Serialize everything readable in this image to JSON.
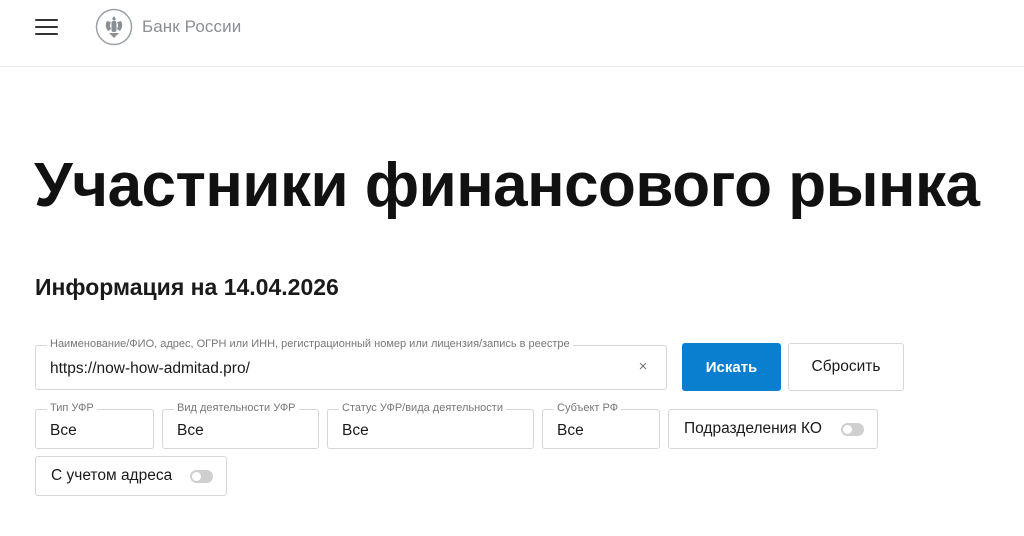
{
  "header": {
    "logo_text": "Банк России"
  },
  "page": {
    "title": "Участники финансового рынка",
    "info_date": "Информация на 14.04.2026"
  },
  "search": {
    "legend": "Наименование/ФИО, адрес, ОГРН или ИНН, регистрационный номер или лицензия/запись в реестре",
    "value": "https://now-how-admitad.pro/",
    "clear_symbol": "×",
    "search_button": "Искать",
    "reset_button": "Сбросить"
  },
  "filters": {
    "type": {
      "legend": "Тип УФР",
      "value": "Все"
    },
    "activity": {
      "legend": "Вид деятельности УФР",
      "value": "Все"
    },
    "status": {
      "legend": "Статус УФР/вида деятельности",
      "value": "Все"
    },
    "region": {
      "legend": "Субъект РФ",
      "value": "Все"
    },
    "branches_toggle": {
      "label": "Подразделения КО",
      "enabled": false
    },
    "address_toggle": {
      "label": "С учетом адреса",
      "enabled": false
    }
  }
}
